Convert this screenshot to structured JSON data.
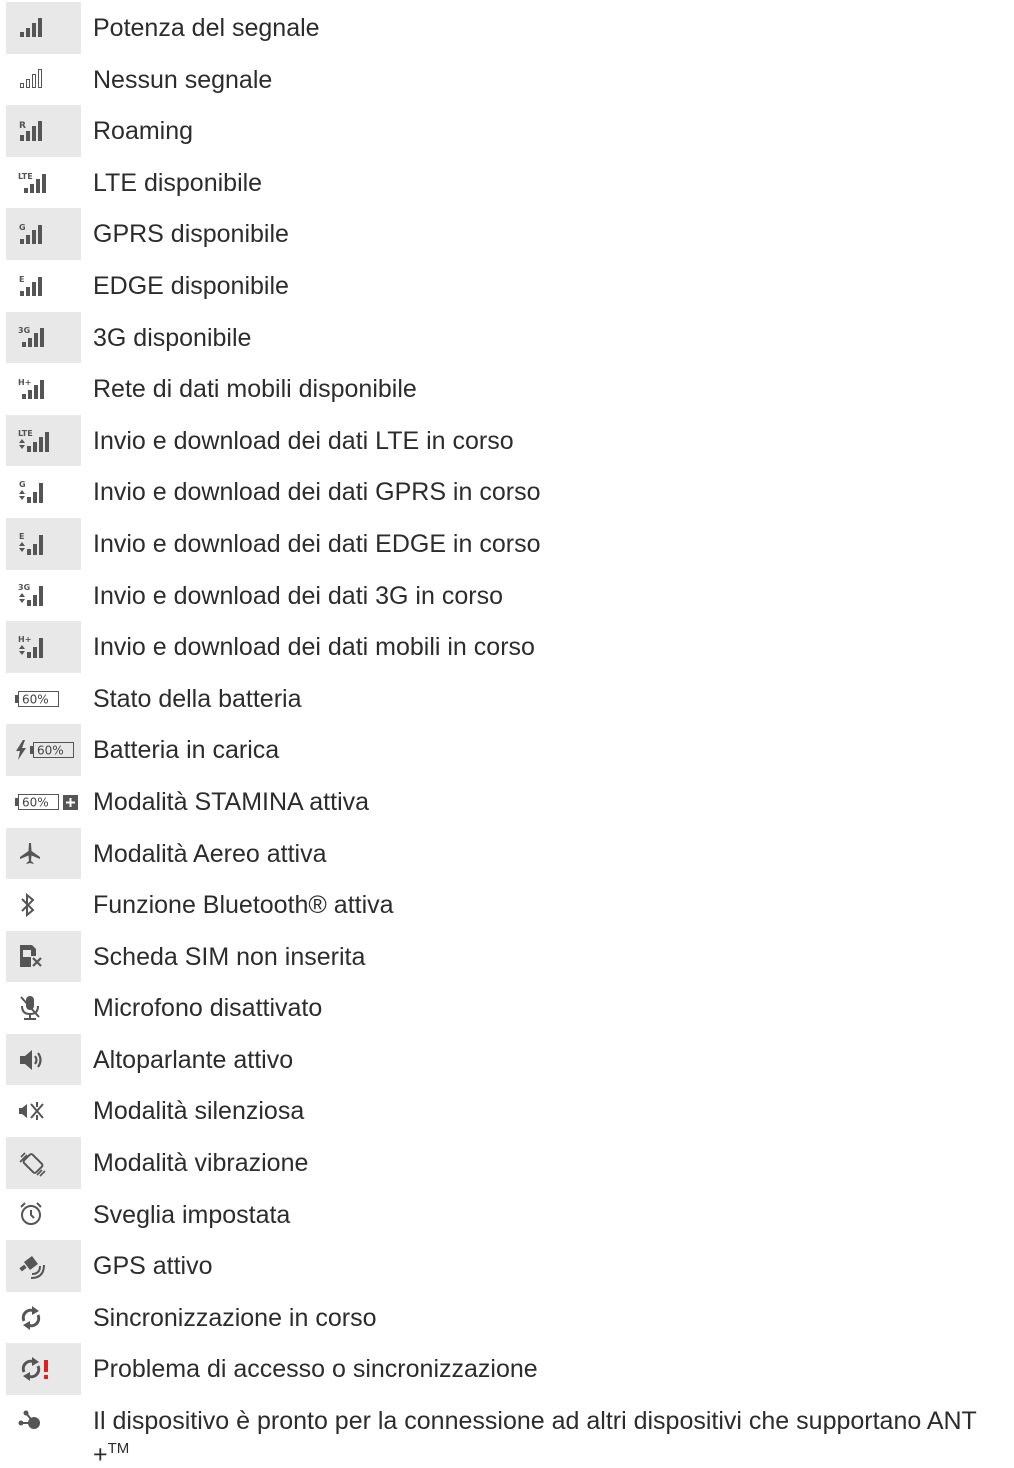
{
  "items": [
    {
      "icon": "signal-strength-icon",
      "label": "Potenza del segnale"
    },
    {
      "icon": "no-signal-icon",
      "label": "Nessun segnale"
    },
    {
      "icon": "roaming-icon",
      "label": "Roaming"
    },
    {
      "icon": "lte-icon",
      "label": "LTE disponibile"
    },
    {
      "icon": "gprs-icon",
      "label": "GPRS disponibile"
    },
    {
      "icon": "edge-icon",
      "label": "EDGE disponibile"
    },
    {
      "icon": "3g-icon",
      "label": "3G disponibile"
    },
    {
      "icon": "hplus-icon",
      "label": "Rete di dati mobili disponibile"
    },
    {
      "icon": "lte-transfer-icon",
      "label": "Invio e download dei dati LTE in corso"
    },
    {
      "icon": "gprs-transfer-icon",
      "label": "Invio e download dei dati GPRS in corso"
    },
    {
      "icon": "edge-transfer-icon",
      "label": "Invio e download dei dati EDGE in corso"
    },
    {
      "icon": "3g-transfer-icon",
      "label": "Invio e download dei dati 3G in corso"
    },
    {
      "icon": "hplus-transfer-icon",
      "label": "Invio e download dei dati mobili in corso"
    },
    {
      "icon": "battery-icon",
      "label": "Stato della batteria",
      "icon_text": "60%"
    },
    {
      "icon": "battery-charging-icon",
      "label": "Batteria in carica",
      "icon_text": "60%"
    },
    {
      "icon": "stamina-icon",
      "label": "Modalità STAMINA attiva",
      "icon_text": "60%"
    },
    {
      "icon": "airplane-icon",
      "label": "Modalità Aereo attiva"
    },
    {
      "icon": "bluetooth-icon",
      "label": "Funzione Bluetooth® attiva"
    },
    {
      "icon": "no-sim-icon",
      "label": "Scheda SIM non inserita"
    },
    {
      "icon": "mic-muted-icon",
      "label": "Microfono disattivato"
    },
    {
      "icon": "speaker-icon",
      "label": "Altoparlante attivo"
    },
    {
      "icon": "silent-icon",
      "label": "Modalità silenziosa"
    },
    {
      "icon": "vibrate-icon",
      "label": "Modalità vibrazione"
    },
    {
      "icon": "alarm-icon",
      "label": "Sveglia impostata"
    },
    {
      "icon": "gps-icon",
      "label": "GPS attivo"
    },
    {
      "icon": "sync-icon",
      "label": "Sincronizzazione in corso"
    },
    {
      "icon": "sync-error-icon",
      "label": "Problema di accesso o sincronizzazione"
    },
    {
      "icon": "ant-icon",
      "label": "Il dispositivo è pronto per la connessione ad altri dispositivi che supportano ANT +",
      "label_sup": "TM"
    }
  ],
  "colors": {
    "stripe": "#e8e8e8",
    "icon": "#555555",
    "alert": "#e02020"
  }
}
